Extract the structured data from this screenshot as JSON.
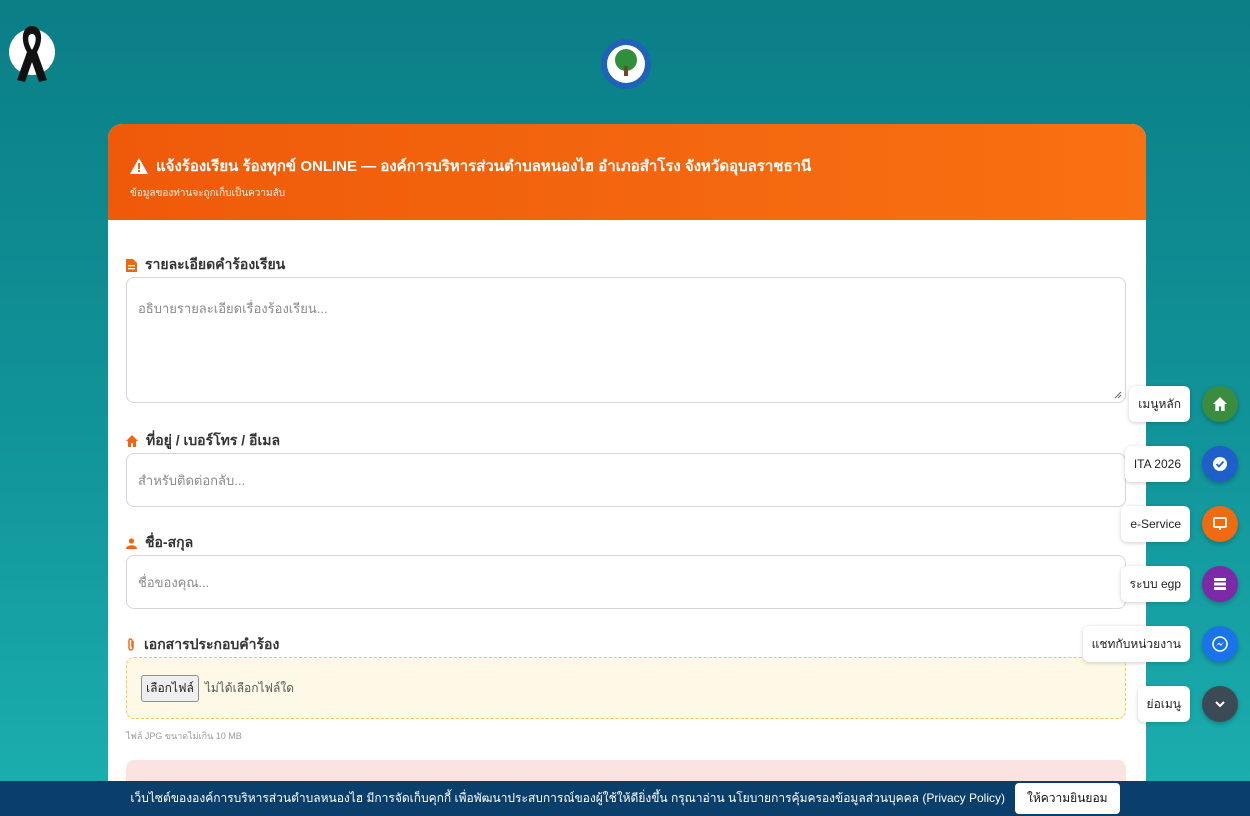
{
  "header": {
    "title": "แจ้งร้องเรียน ร้องทุกข์ ONLINE — องค์การบริหารส่วนตำบลหนองไฮ อำเภอสำโรง จังหวัดอุบลราชธานี",
    "subtitle": "ข้อมูลของท่านจะถูกเก็บเป็นความลับ"
  },
  "form": {
    "details": {
      "label": "รายละเอียดคำร้องเรียน",
      "placeholder": "อธิบายรายละเอียดเรื่องร้องเรียน..."
    },
    "contact": {
      "label": "ที่อยู่ / เบอร์โทร / อีเมล",
      "placeholder": "สำหรับติดต่อกลับ..."
    },
    "name": {
      "label": "ชื่อ-สกุล",
      "placeholder": "ชื่อของคุณ..."
    },
    "attachment": {
      "label": "เอกสารประกอบคำร้อง",
      "button": "เลือกไฟล์",
      "status": "ไม่ได้เลือกไฟล์ใด",
      "hint": "ไฟล์ JPG ขนาดไม่เกิน 10 MB"
    }
  },
  "quick_menu": [
    {
      "label": "เมนูหลัก",
      "icon": "home-icon",
      "color": "#3a8d3f"
    },
    {
      "label": "ITA 2026",
      "icon": "verified-badge-icon",
      "color": "#1f5fc9"
    },
    {
      "label": "e-Service",
      "icon": "monitor-icon",
      "color": "#f06a12"
    },
    {
      "label": "ระบบ egp",
      "icon": "grid-icon",
      "color": "#7d2aa8"
    },
    {
      "label": "แชทกับหน่วยงาน",
      "icon": "messenger-icon",
      "color": "#1a73e8"
    },
    {
      "label": "ย่อเมนู",
      "icon": "chevron-down-icon",
      "color": "#3c4a55"
    }
  ],
  "cookie_bar": {
    "text": "เว็บไซต์ขององค์การบริหารส่วนตำบลหนองไฮ มีการจัดเก็บคุกกี้ เพื่อพัฒนาประสบการณ์ของผู้ใช้ให้ดียิ่งขึ้น กรุณาอ่าน นโยบายการคุ้มครองข้อมูลส่วนบุคคล (Privacy Policy)",
    "accept": "ให้ความยินยอม"
  },
  "colors": {
    "header_orange": "#f26410",
    "page_teal": "#0e8a90",
    "cookie_bar": "#0a3f6b"
  }
}
